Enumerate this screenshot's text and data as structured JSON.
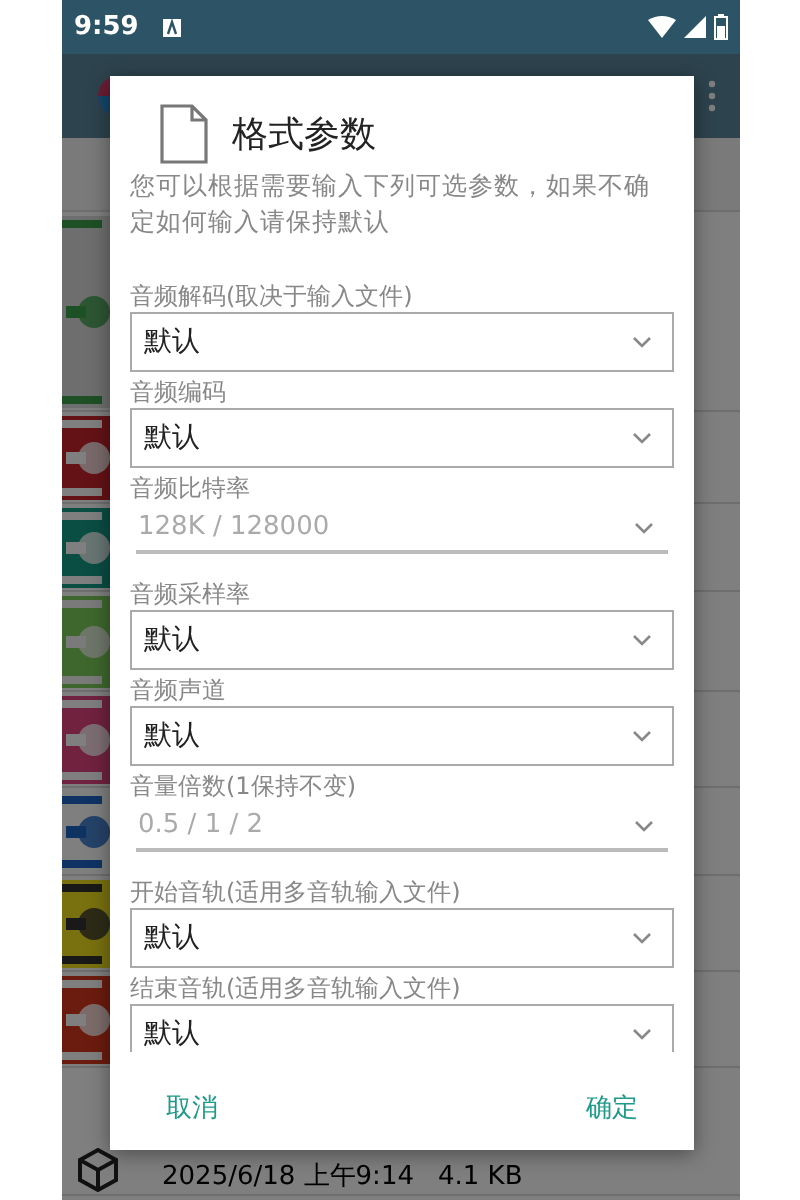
{
  "status_bar": {
    "time": "9:59"
  },
  "file_row": {
    "date": "2025/6/18 上午9:14",
    "size": "4.1 KB"
  },
  "dialog": {
    "title": "格式参数",
    "description": "您可以根据需要输入下列可选参数，如果不确定如何输入请保持默认",
    "fields": [
      {
        "kind": "select",
        "label": "音频解码(取决于输入文件)",
        "value": "默认"
      },
      {
        "kind": "select",
        "label": "音频编码",
        "value": "默认"
      },
      {
        "kind": "input",
        "label": "音频比特率",
        "placeholder": "128K / 128000"
      },
      {
        "kind": "select",
        "label": "音频采样率",
        "value": "默认"
      },
      {
        "kind": "select",
        "label": "音频声道",
        "value": "默认"
      },
      {
        "kind": "input",
        "label": "音量倍数(1保持不变)",
        "placeholder": "0.5 / 1 / 2"
      },
      {
        "kind": "select",
        "label": "开始音轨(适用多音轨输入文件)",
        "value": "默认"
      },
      {
        "kind": "select",
        "label": "结束音轨(适用多音轨输入文件)",
        "value": "默认"
      }
    ],
    "buttons": [
      {
        "label": "取消"
      },
      {
        "label": "确定"
      }
    ]
  }
}
